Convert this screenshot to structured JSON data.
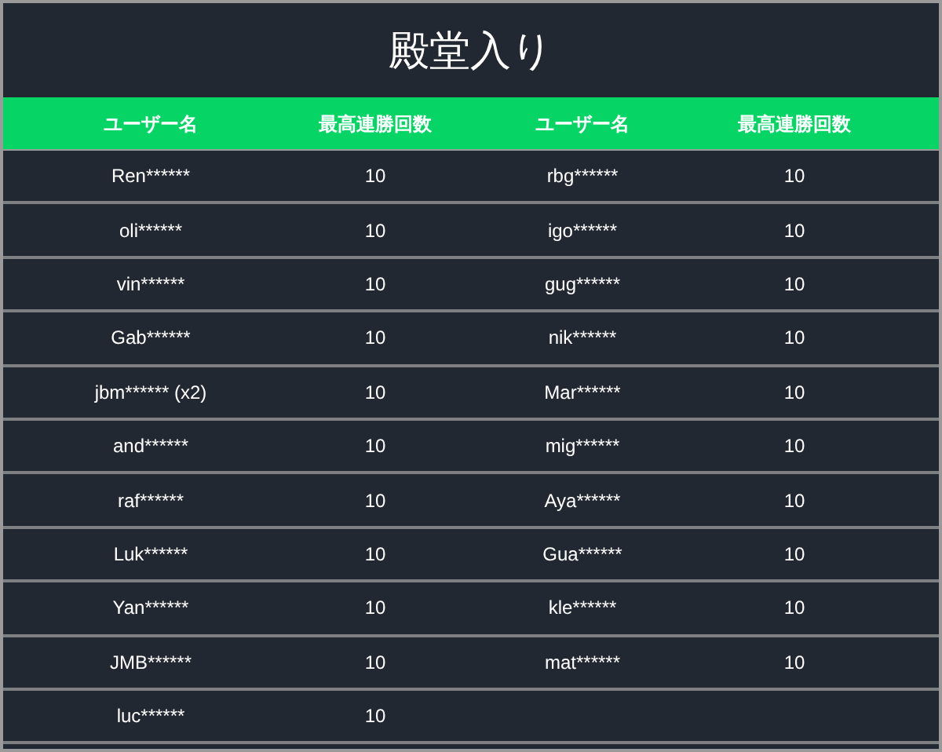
{
  "title": "殿堂入り",
  "table": {
    "columns": [
      "ユーザー名",
      "最高連勝回数",
      "ユーザー名",
      "最高連勝回数"
    ],
    "rows": [
      [
        "Ren******",
        "10",
        "rbg******",
        "10"
      ],
      [
        "oli******",
        "10",
        "igo******",
        "10"
      ],
      [
        "vin******",
        "10",
        "gug******",
        "10"
      ],
      [
        "Gab******",
        "10",
        "nik******",
        "10"
      ],
      [
        "jbm****** (x2)",
        "10",
        "Mar******",
        "10"
      ],
      [
        "and******",
        "10",
        "mig******",
        "10"
      ],
      [
        "raf******",
        "10",
        "Aya******",
        "10"
      ],
      [
        "Luk******",
        "10",
        "Gua******",
        "10"
      ],
      [
        "Yan******",
        "10",
        "kle******",
        "10"
      ],
      [
        "JMB******",
        "10",
        "mat******",
        "10"
      ],
      [
        "luc******",
        "10"
      ]
    ]
  }
}
